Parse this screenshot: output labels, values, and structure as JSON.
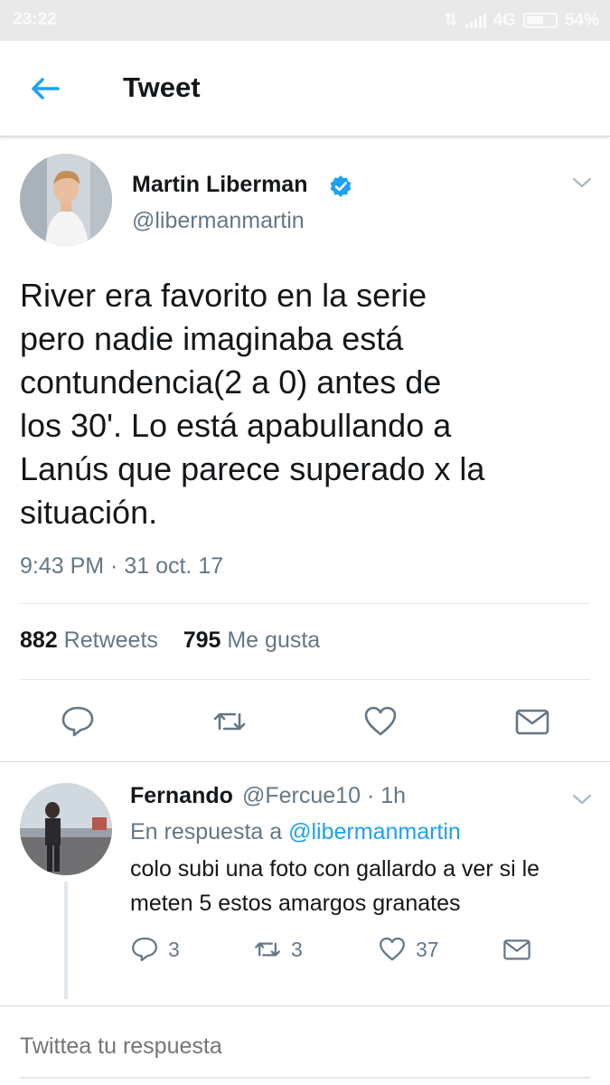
{
  "status_bar": {
    "time": "23:22",
    "network": "4G",
    "battery": "54%"
  },
  "header": {
    "title": "Tweet"
  },
  "tweet": {
    "author_name": "Martin Liberman",
    "author_handle": "@libermanmartin",
    "text": "River era favorito en la serie\npero nadie imaginaba está\ncontundencia(2 a 0) antes de\nlos 30'. Lo está apabullando a\nLanús que parece superado x la\nsituación.",
    "timestamp": "9:43 PM · 31 oct. 17",
    "retweets_count": "882",
    "retweets_label": "Retweets",
    "likes_count": "795",
    "likes_label": "Me gusta"
  },
  "reply": {
    "author_name": "Fernando",
    "author_handle_time": "@Fercue10 · 1h",
    "in_reply_prefix": "En respuesta a",
    "in_reply_handle": "@libermanmartin",
    "text": "colo subi una foto con gallardo a ver si le\nmeten 5 estos amargos granates",
    "reply_count": "3",
    "retweet_count": "3",
    "like_count": "37"
  },
  "composer": {
    "placeholder": "Twittea tu respuesta"
  },
  "colors": {
    "accent": "#1da1f2",
    "text_primary": "#14171a",
    "text_secondary": "#657786",
    "divider": "#e1e8ed"
  },
  "icons": {
    "back": "arrow-left-icon",
    "verified": "verified-badge-icon",
    "chevron": "chevron-down-icon",
    "reply": "reply-icon",
    "retweet": "retweet-icon",
    "like": "heart-icon",
    "message": "envelope-icon"
  }
}
